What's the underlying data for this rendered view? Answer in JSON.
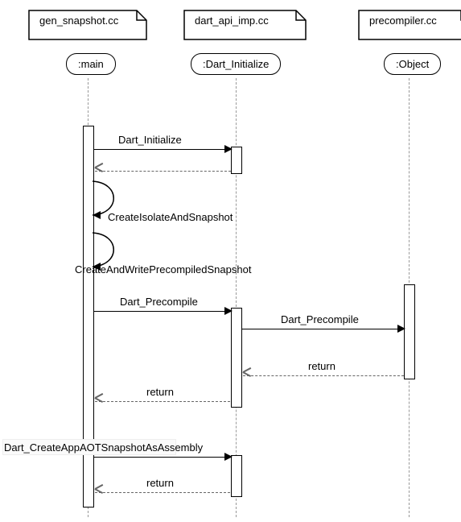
{
  "participants": {
    "p1": {
      "file": "gen_snapshot.cc",
      "label": ":main"
    },
    "p2": {
      "file": "dart_api_imp.cc",
      "label": ":Dart_Initialize"
    },
    "p3": {
      "file": "precompiler.cc",
      "label": ":Object"
    }
  },
  "messages": {
    "m1": {
      "text": "Dart_Initialize",
      "from": "p1",
      "to": "p2",
      "kind": "call"
    },
    "m2": {
      "text": "",
      "from": "p2",
      "to": "p1",
      "kind": "return"
    },
    "m3": {
      "text": "CreateIsolateAndSnapshot",
      "from": "p1",
      "to": "p1",
      "kind": "self"
    },
    "m4": {
      "text": "CreateAndWritePrecompiledSnapshot",
      "from": "p1",
      "to": "p1",
      "kind": "self"
    },
    "m5": {
      "text": "Dart_Precompile",
      "from": "p1",
      "to": "p2",
      "kind": "call"
    },
    "m6": {
      "text": "Dart_Precompile",
      "from": "p2",
      "to": "p3",
      "kind": "call"
    },
    "m7": {
      "text": "return",
      "from": "p3",
      "to": "p2",
      "kind": "return"
    },
    "m8": {
      "text": "return",
      "from": "p2",
      "to": "p1",
      "kind": "return"
    },
    "m9": {
      "text": "Dart_CreateAppAOTSnapshotAsAssembly",
      "from": "p1",
      "to": "p2",
      "kind": "call"
    },
    "m10": {
      "text": "return",
      "from": "p2",
      "to": "p1",
      "kind": "return"
    }
  }
}
